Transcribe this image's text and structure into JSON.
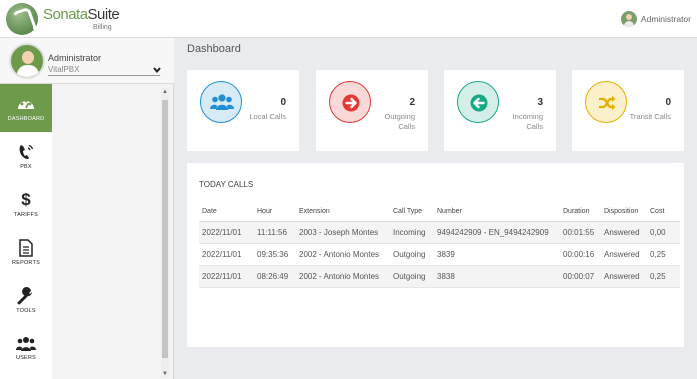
{
  "header": {
    "brand_part1": "Sonata",
    "brand_part2": "Suite",
    "brand_sub": "Billing",
    "user": "Administrator"
  },
  "sidebar": {
    "user_name": "Administrator",
    "user_org": "VitalPBX",
    "nav": [
      {
        "label": "DASHBOARD",
        "icon": "dashboard-gauge-icon",
        "active": true
      },
      {
        "label": "PBX",
        "icon": "phone-icon",
        "active": false
      },
      {
        "label": "TARIFFS",
        "icon": "dollar-icon",
        "active": false
      },
      {
        "label": "REPORTS",
        "icon": "document-icon",
        "active": false
      },
      {
        "label": "TOOLS",
        "icon": "wrench-icon",
        "active": false
      },
      {
        "label": "USERS",
        "icon": "users-icon",
        "active": false
      }
    ]
  },
  "main": {
    "title": "Dashboard",
    "cards": [
      {
        "value": "0",
        "label_lines": [
          "Local Calls"
        ],
        "icon": "users-icon",
        "color": "#1f8fd6",
        "bg": "#d7ebf6"
      },
      {
        "value": "2",
        "label_lines": [
          "Outgoing",
          "Calls"
        ],
        "icon": "arrow-right-icon",
        "color": "#e53935",
        "bg": "#f8d9d8"
      },
      {
        "value": "3",
        "label_lines": [
          "Incoming",
          "Calls"
        ],
        "icon": "arrow-left-icon",
        "color": "#17a985",
        "bg": "#d3efe8"
      },
      {
        "value": "0",
        "label_lines": [
          "Transit Calls"
        ],
        "icon": "shuffle-icon",
        "color": "#e4b000",
        "bg": "#fbf0c9"
      }
    ],
    "today_calls": {
      "title": "TODAY CALLS",
      "columns": [
        "Date",
        "Hour",
        "Extension",
        "Call Type",
        "Number",
        "Duration",
        "Disposition",
        "Cost"
      ],
      "rows": [
        {
          "date": "2022/11/01",
          "hour": "11:11:56",
          "extension": "2003 - Joseph Montes",
          "call_type": "Incoming",
          "number": "9494242909 - EN_9494242909",
          "duration": "00:01:55",
          "disposition": "Answered",
          "cost": "0,00"
        },
        {
          "date": "2022/11/01",
          "hour": "09:35:36",
          "extension": "2002 - Antonio Montes",
          "call_type": "Outgoing",
          "number": "3839",
          "duration": "00:00:16",
          "disposition": "Answered",
          "cost": "0,25"
        },
        {
          "date": "2022/11/01",
          "hour": "08:26:49",
          "extension": "2002 - Antonio Montes",
          "call_type": "Outgoing",
          "number": "3838",
          "duration": "00:00:07",
          "disposition": "Answered",
          "cost": "0,25"
        }
      ]
    }
  }
}
